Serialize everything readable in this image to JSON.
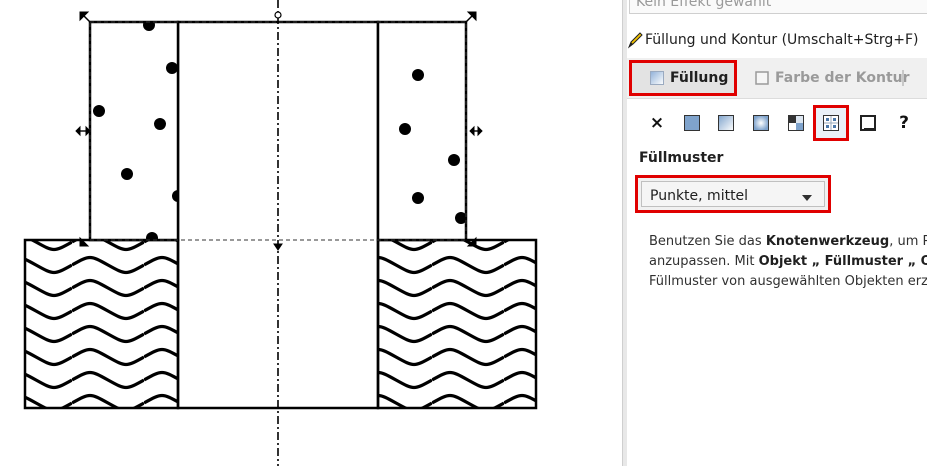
{
  "effect_bar": {
    "text": "Kein Effekt gewählt"
  },
  "dialog": {
    "title": "Füllung und Kontur (Umschalt+Strg+F)"
  },
  "tabs": [
    {
      "label": "Füllung",
      "active": true
    },
    {
      "label": "Farbe der Kontur",
      "active": false
    }
  ],
  "fill_types": [
    {
      "name": "none",
      "icon": "x-icon",
      "glyph": "×"
    },
    {
      "name": "flat-color",
      "icon": "flat-color-icon"
    },
    {
      "name": "linear-gradient",
      "icon": "linear-gradient-icon"
    },
    {
      "name": "radial-gradient",
      "icon": "radial-gradient-icon"
    },
    {
      "name": "mesh-gradient",
      "icon": "mesh-gradient-icon"
    },
    {
      "name": "pattern",
      "icon": "pattern-icon",
      "selected": true
    },
    {
      "name": "swatch",
      "icon": "swatch-icon"
    },
    {
      "name": "unset",
      "icon": "question-icon",
      "glyph": "?"
    }
  ],
  "pattern_section": {
    "label": "Füllmuster",
    "selected_pattern": "Punkte, mittel"
  },
  "hint": {
    "line1_pre": "Benutzen Sie das ",
    "line1_bold": "Knotenwerkzeug",
    "line1_post": ", um Po",
    "line2_pre": "anzupassen. Mit ",
    "line2_bold": "Objekt „ Füllmuster „ Ob",
    "line3": "Füllmuster von ausgewählten Objekten erz"
  },
  "colors": {
    "highlight": "#e00000",
    "panel_bg": "#ffffff",
    "tab_bar_bg": "#f0f0f0"
  }
}
